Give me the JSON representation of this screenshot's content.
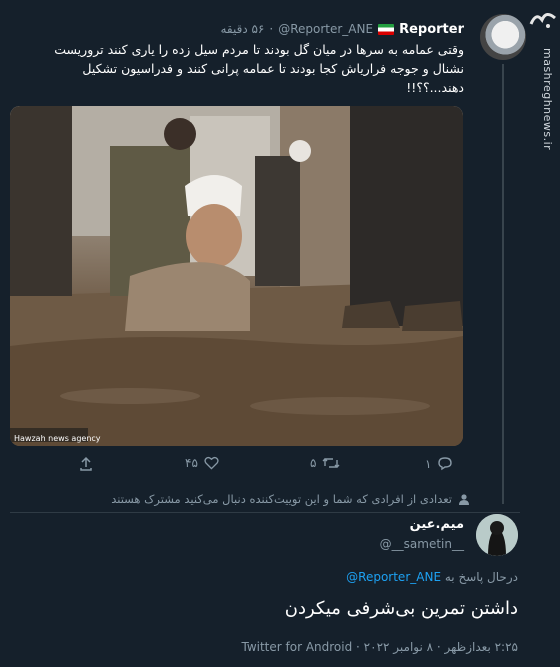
{
  "watermark": {
    "site": "mashreghnews.ir",
    "logo_text": "مشرق"
  },
  "quoted_tweet": {
    "author_name": "Reporter",
    "handle": "@Reporter_ANE",
    "separator": "·",
    "time": "۵۶ دقیقه",
    "text": "وقتی عمامه به سرها در میان گل بودند تا مردم سیل زده را یاری کنند تروریست نشنال و جوجه فراریاش کجا بودند تا عمامه پرانی کنند و فدراسیون تشکیل دهند...؟؟!!",
    "image_caption": "Hawzah news agency",
    "actions": {
      "reply_count": "۱",
      "retweet_count": "۵",
      "like_count": "۴۵"
    },
    "subscriber_notice": "تعدادی از افرادی که شما و این توییت‌کننده دنبال می‌کنید مشترک هستند"
  },
  "reply_tweet": {
    "author_name": "میم.عین",
    "handle": "@__sametin__",
    "reply_prefix": "درحال پاسخ به",
    "reply_to": "@Reporter_ANE",
    "text": "داشتن تمرین بی‌شرفی میکردن",
    "timestamp": "۲:۲۵ بعدازظهر · ۸ نوامبر ۲۰۲۲ · Twitter for Android"
  },
  "colors": {
    "background": "#15202b",
    "accent": "#1da1f2",
    "muted": "#8899a6"
  }
}
